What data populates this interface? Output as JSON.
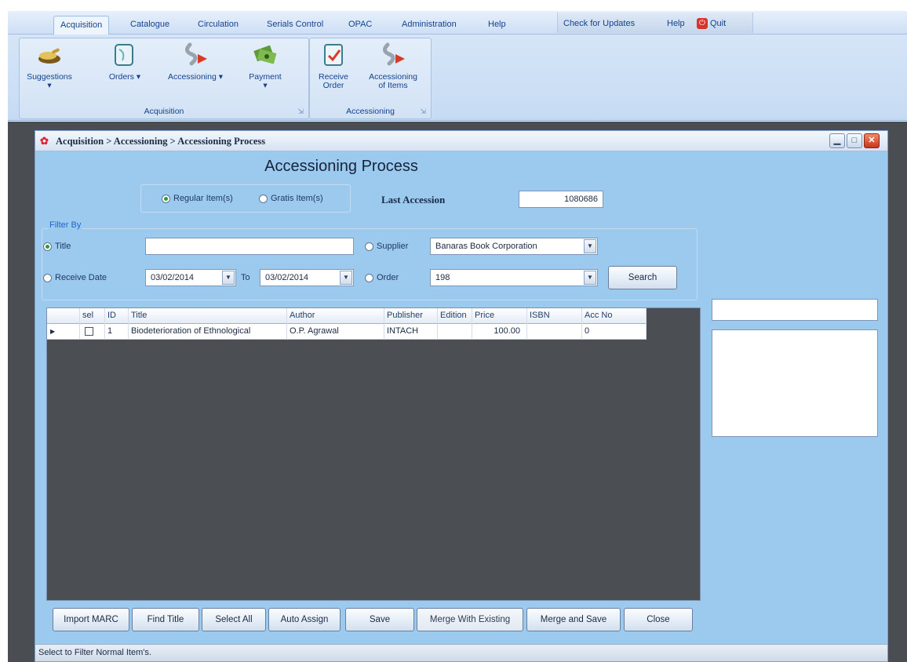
{
  "ribbon": {
    "tabs": [
      "Acquisition",
      "Catalogue",
      "Circulation",
      "Serials Control",
      "OPAC",
      "Administration",
      "Help"
    ],
    "active_tab": "Acquisition",
    "right": {
      "check_updates": "Check for Updates",
      "help": "Help",
      "quit": "Quit"
    },
    "groups": {
      "acquisition": {
        "label": "Acquisition",
        "buttons": {
          "suggestions": "Suggestions",
          "orders": "Orders",
          "accessioning": "Accessioning",
          "payment": "Payment"
        }
      },
      "accessioning": {
        "label": "Accessioning",
        "buttons": {
          "receive_order_1": "Receive",
          "receive_order_2": "Order",
          "acc_items_1": "Accessioning",
          "acc_items_2": "of Items"
        }
      }
    },
    "icons": [
      "suggestions-icon",
      "orders-icon",
      "accessioning-icon",
      "payment-icon",
      "receive-order-icon",
      "accessioning-items-icon"
    ]
  },
  "window": {
    "title": "Acquisition > Accessioning > Accessioning Process",
    "heading": "Accessioning Process",
    "item_type": {
      "regular": "Regular Item(s)",
      "gratis": "Gratis Item(s)",
      "selected": "regular"
    },
    "last_accession": {
      "label": "Last Accession",
      "value": "1080686"
    },
    "filter": {
      "legend": "Filter By",
      "title_label": "Title",
      "title_value": "",
      "receive_date_label": "Receive Date",
      "date_from": "03/02/2014",
      "to_label": "To",
      "date_to": "03/02/2014",
      "supplier_label": "Supplier",
      "supplier_value": "Banaras Book Corporation",
      "order_label": "Order",
      "order_value": "198",
      "search": "Search",
      "selected": "title"
    },
    "grid": {
      "columns": [
        "sel",
        "ID",
        "Title",
        "Author",
        "Publisher",
        "Edition",
        "Price",
        "ISBN",
        "Acc No"
      ],
      "rows": [
        {
          "sel": false,
          "id": "1",
          "title": "Biodeterioration of Ethnological",
          "author": "O.P. Agrawal",
          "publisher": "INTACH",
          "edition": "",
          "price": "100.00",
          "isbn": "",
          "acc_no": "0"
        }
      ]
    },
    "buttons": {
      "import_marc": "Import MARC",
      "find_title": "Find Title",
      "select_all": "Select All",
      "auto_assign": "Auto Assign",
      "save": "Save",
      "merge_existing": "Merge With Existing",
      "merge_save": "Merge and Save",
      "close": "Close"
    },
    "status": "Select to Filter Normal Item's."
  }
}
